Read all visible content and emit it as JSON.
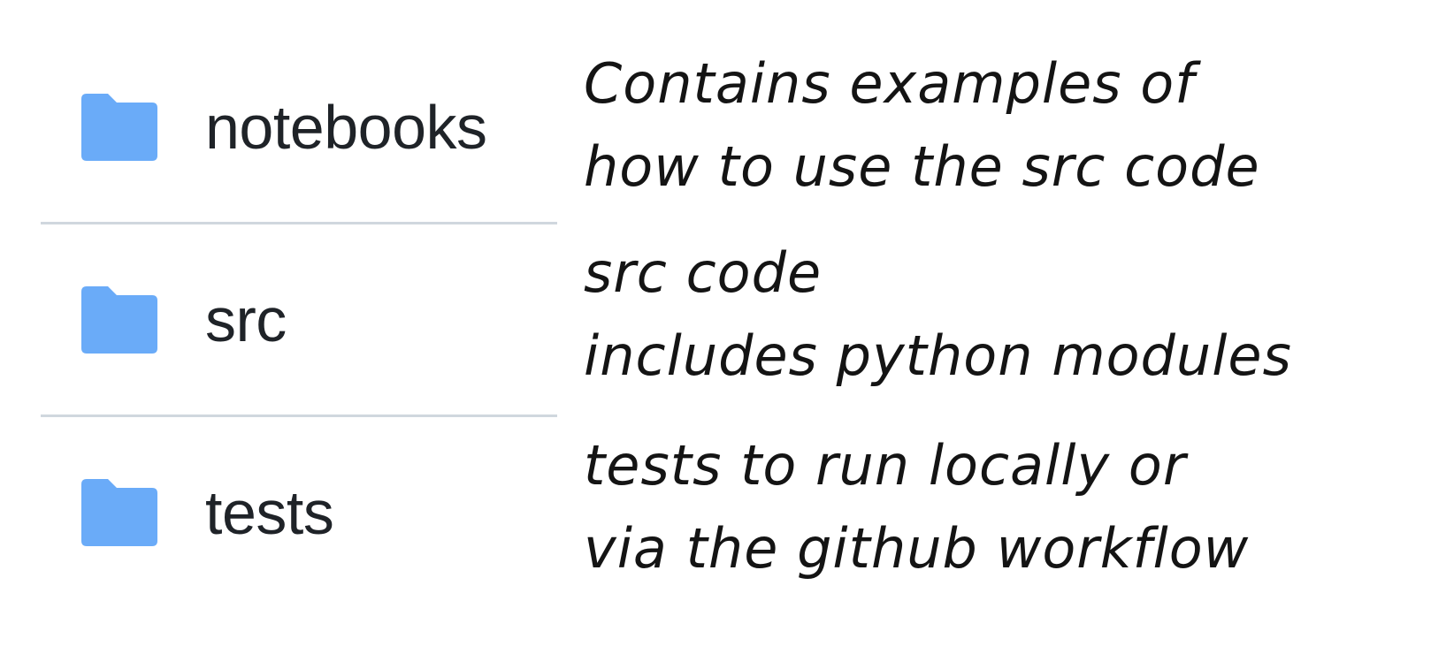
{
  "files": [
    {
      "name": "notebooks",
      "icon": "folder-icon"
    },
    {
      "name": "src",
      "icon": "folder-icon"
    },
    {
      "name": "tests",
      "icon": "folder-icon"
    }
  ],
  "notes": [
    {
      "lines": [
        "Contains examples of",
        "how to use the src code"
      ]
    },
    {
      "lines": [
        "src code",
        "includes python modules"
      ]
    },
    {
      "lines": [
        "tests to run locally or",
        "via the github workflow"
      ]
    }
  ],
  "colors": {
    "folder": "#6aabf8",
    "divider": "#d0d7de",
    "text": "#1f2328"
  }
}
